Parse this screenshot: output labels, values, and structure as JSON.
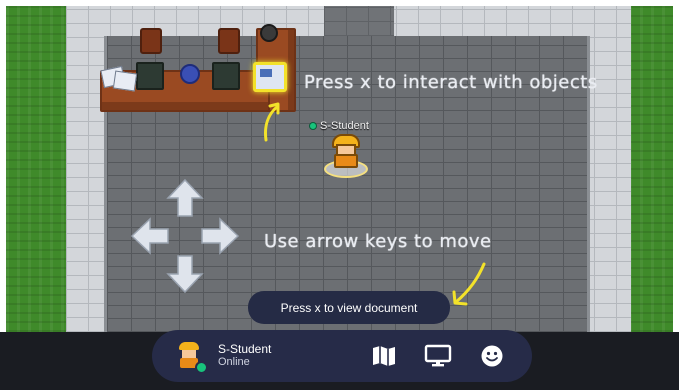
{
  "world": {
    "hint_interact": "Press x to interact with objects",
    "hint_move": "Use arrow keys to move",
    "player_tag": "S-Student",
    "doc_prompt": "Press x to view document"
  },
  "hud": {
    "player_name": "S-Student",
    "status": "Online",
    "icons": [
      "map-icon",
      "screen-share-icon",
      "emoji-icon"
    ]
  },
  "colors": {
    "hud_background": "#262b48",
    "online_green": "#18c37c",
    "highlight_yellow": "#f3e22a"
  }
}
